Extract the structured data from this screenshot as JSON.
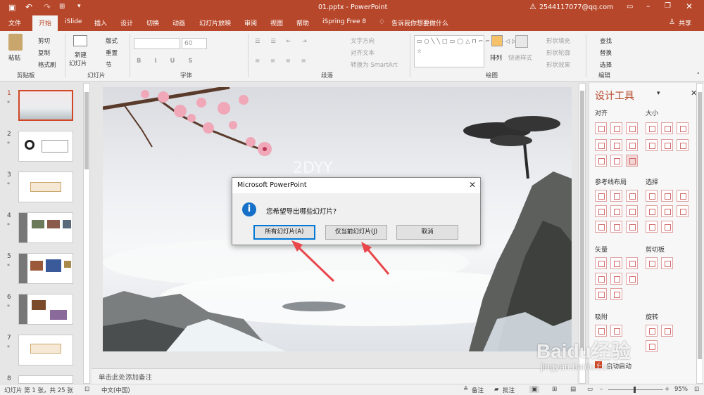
{
  "window": {
    "title": "01.pptx - PowerPoint",
    "account_warning": "2544117077@qq.com"
  },
  "tabs": [
    "文件",
    "开始",
    "iSlide",
    "插入",
    "设计",
    "切换",
    "动画",
    "幻灯片放映",
    "审阅",
    "视图",
    "帮助",
    "iSpring Free 8"
  ],
  "active_tab": "开始",
  "tell_me": "告诉我你想要做什么",
  "share": "共享",
  "ribbon": {
    "clipboard": {
      "paste": "粘贴",
      "cut": "剪切",
      "copy": "复制",
      "format_painter": "格式刷",
      "label": "剪贴板"
    },
    "slides": {
      "new_slide": "新建",
      "new_slide2": "幻灯片",
      "layout": "版式",
      "reset": "重置",
      "section": "节",
      "label": "幻灯片"
    },
    "font": {
      "font_name": "",
      "font_size": "60",
      "label": "字体"
    },
    "paragraph": {
      "text_direction": "文字方向",
      "align_text": "对齐文本",
      "smartart": "转换为 SmartArt",
      "label": "段落"
    },
    "drawing": {
      "arrange": "排列",
      "quick_styles": "快速样式",
      "shape_fill": "形状填充",
      "shape_outline": "形状轮廓",
      "shape_effects": "形状效果",
      "label": "绘图"
    },
    "editing": {
      "find": "查找",
      "replace": "替换",
      "select": "选择",
      "label": "编辑"
    }
  },
  "slides": [
    "1",
    "2",
    "3",
    "4",
    "5",
    "6",
    "7",
    "8"
  ],
  "notes_placeholder": "单击此处添加备注",
  "design_pane": {
    "title": "设计工具",
    "sections": {
      "align": "对齐",
      "size": "大小",
      "guides": "参考线布局",
      "select": "选择",
      "vector": "矢量",
      "clip": "剪切板",
      "snap": "吸附",
      "rotate": "旋转"
    },
    "autostart": "自动启动"
  },
  "dialog": {
    "title": "Microsoft PowerPoint",
    "message": "您希望导出哪些幻灯片?",
    "btn_all": "所有幻灯片(A)",
    "btn_current": "仅当前幻灯片(J)",
    "btn_cancel": "取消"
  },
  "slide_watermark": "2DYY",
  "status": {
    "slide_info": "幻灯片 第 1 张，共 25 张",
    "language": "中文(中国)",
    "notes": "备注",
    "comments": "批注",
    "zoom": "95%"
  },
  "watermark": {
    "brand": "Baidu经验",
    "url": "jingyan.baidu.com"
  },
  "colors": {
    "accent": "#b7472a",
    "arrow": "#e8464a",
    "info_icon": "#1670c8"
  }
}
